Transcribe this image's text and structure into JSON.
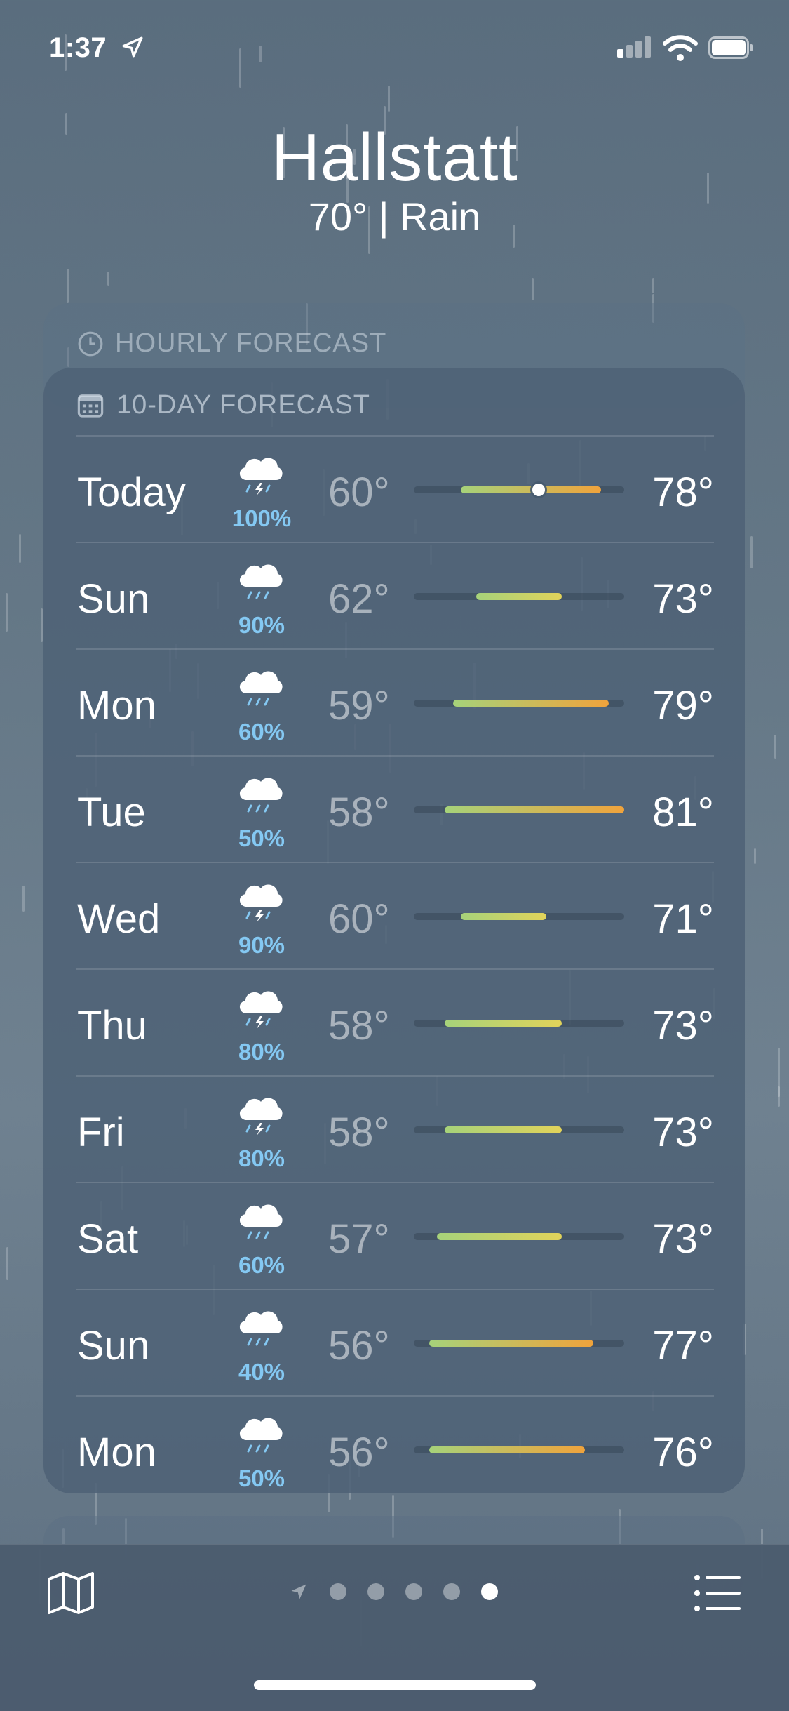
{
  "status_bar": {
    "time": "1:37"
  },
  "location": {
    "city": "Hallstatt",
    "summary": "70°  |  Rain"
  },
  "hourly": {
    "title": "HOURLY FORECAST"
  },
  "forecast": {
    "title": "10-DAY FORECAST",
    "days": [
      {
        "day": "Today",
        "icon": "cloud-bolt-rain-icon",
        "precip": "100%",
        "low": "60°",
        "high": "78°",
        "current_temp": 70
      },
      {
        "day": "Sun",
        "icon": "cloud-rain-icon",
        "precip": "90%",
        "low": "62°",
        "high": "73°"
      },
      {
        "day": "Mon",
        "icon": "cloud-rain-icon",
        "precip": "60%",
        "low": "59°",
        "high": "79°"
      },
      {
        "day": "Tue",
        "icon": "cloud-rain-icon",
        "precip": "50%",
        "low": "58°",
        "high": "81°"
      },
      {
        "day": "Wed",
        "icon": "cloud-bolt-rain-icon",
        "precip": "90%",
        "low": "60°",
        "high": "71°"
      },
      {
        "day": "Thu",
        "icon": "cloud-bolt-rain-icon",
        "precip": "80%",
        "low": "58°",
        "high": "73°"
      },
      {
        "day": "Fri",
        "icon": "cloud-bolt-rain-icon",
        "precip": "80%",
        "low": "58°",
        "high": "73°"
      },
      {
        "day": "Sat",
        "icon": "cloud-rain-icon",
        "precip": "60%",
        "low": "57°",
        "high": "73°"
      },
      {
        "day": "Sun",
        "icon": "cloud-rain-icon",
        "precip": "40%",
        "low": "56°",
        "high": "77°"
      },
      {
        "day": "Mon",
        "icon": "cloud-rain-icon",
        "precip": "50%",
        "low": "56°",
        "high": "76°"
      }
    ],
    "range": {
      "min": 54,
      "max": 81
    }
  },
  "pager": {
    "pages": 5,
    "active_index": 4
  },
  "colors": {
    "precip": "#84c8f2",
    "cool": "#a6d27a",
    "mid": "#e2d35a",
    "warm": "#f0a33c"
  }
}
